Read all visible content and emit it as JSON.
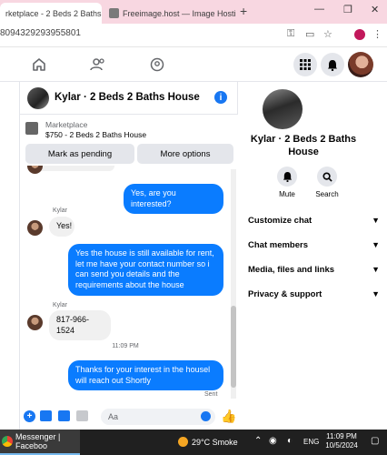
{
  "browser": {
    "tabs": [
      {
        "title": "rketplace - 2 Beds 2 Baths H",
        "active": true
      },
      {
        "title": "Freeimage.host — Image Hosti",
        "active": false
      }
    ],
    "url": "8094329293955801"
  },
  "chat": {
    "title": "Kylar · 2 Beds 2 Baths House",
    "marketplace_label": "Marketplace",
    "listing": "$750 - 2 Beds 2 Baths House",
    "mark_pending_label": "Mark as pending",
    "more_options_label": "More options",
    "messages": [
      {
        "dir": "out",
        "text": "Yes, are you interested?"
      },
      {
        "dir": "in",
        "sender": "Kylar",
        "text": "Yes!"
      },
      {
        "dir": "out",
        "text": "Yes the house is still available for rent, let me have your contact number so i can send you details and the requirements about the house"
      },
      {
        "dir": "in",
        "sender": "Kylar",
        "text": "817-966-1524"
      },
      {
        "dir": "out",
        "text": "Thanks for your interest in the housel will reach out Shortly"
      }
    ],
    "timestamp": "11:09 PM",
    "sent_label": "Sent",
    "composer_placeholder": "Aa"
  },
  "details": {
    "name": "Kylar · 2 Beds 2 Baths House",
    "actions": [
      {
        "label": "Mute",
        "icon": "bell-icon"
      },
      {
        "label": "Search",
        "icon": "search-icon"
      }
    ],
    "sections": [
      "Customize chat",
      "Chat members",
      "Media, files and links",
      "Privacy & support"
    ]
  },
  "taskbar": {
    "app_label": "Messenger | Faceboo",
    "weather": "29°C  Smoke",
    "lang": "ENG",
    "time": "11:09 PM",
    "date": "10/5/2024"
  },
  "colors": {
    "messenger_blue": "#0a7cff",
    "fb_blue": "#1877f2"
  }
}
